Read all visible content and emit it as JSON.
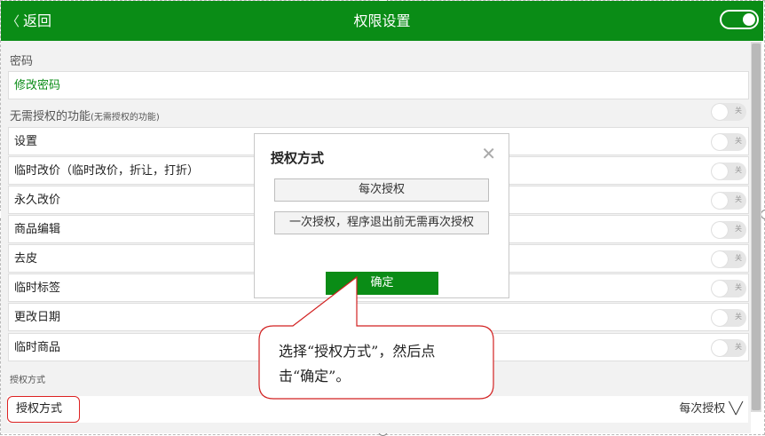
{
  "header": {
    "back_label": "返回",
    "title": "权限设置",
    "master_toggle_on": true
  },
  "sections": {
    "password_label": "密码",
    "change_password": "修改密码",
    "no_auth_label": "无需授权的功能",
    "no_auth_hint": "(无需授权的功能)",
    "auth_method_section": "授权方式"
  },
  "features": [
    {
      "label": "设置",
      "toggle": "关"
    },
    {
      "label": "临时改价（临时改价，折让，打折）",
      "toggle": "关"
    },
    {
      "label": "永久改价",
      "toggle": "关"
    },
    {
      "label": "商品编辑",
      "toggle": "关"
    },
    {
      "label": "去皮",
      "toggle": "关"
    },
    {
      "label": "临时标签",
      "toggle": "关"
    },
    {
      "label": "更改日期",
      "toggle": "关"
    },
    {
      "label": "临时商品",
      "toggle": "关"
    }
  ],
  "bottom": {
    "label": "授权方式",
    "value": "每次授权 ╲╱"
  },
  "dialog": {
    "title": "授权方式",
    "close": "✕",
    "option1": "每次授权",
    "option2": "一次授权，程序退出前无需再次授权",
    "confirm": "确定"
  },
  "callout": {
    "line1": "选择“授权方式”，然后点",
    "line2": "击“确定”。"
  },
  "colors": {
    "brand_green": "#0a8c16",
    "highlight_red": "#d22222"
  }
}
